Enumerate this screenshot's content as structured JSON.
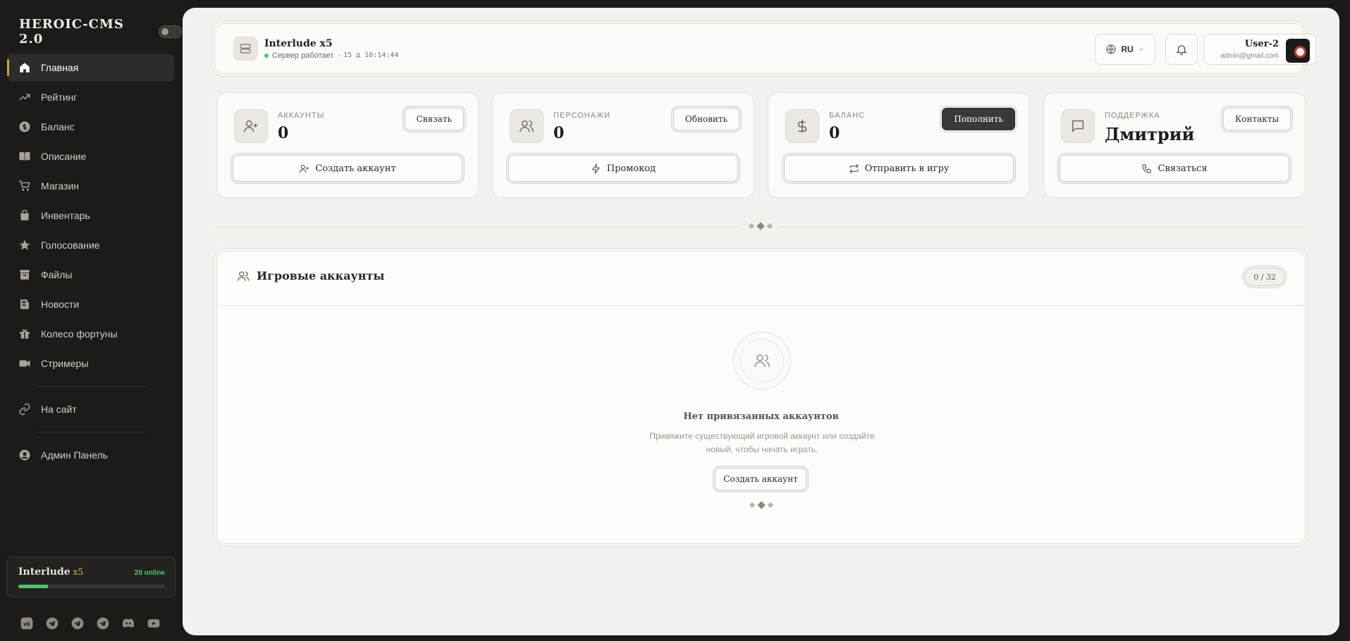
{
  "sidebar": {
    "brand": "HEROIC-CMS 2.0",
    "nav": [
      {
        "label": "Главная",
        "icon": "home-icon",
        "active": true
      },
      {
        "label": "Рейтинг",
        "icon": "trending-icon"
      },
      {
        "label": "Баланс",
        "icon": "dollar-circle-icon"
      },
      {
        "label": "Описание",
        "icon": "book-icon"
      },
      {
        "label": "Магазин",
        "icon": "cart-icon"
      },
      {
        "label": "Инвентарь",
        "icon": "bag-icon"
      },
      {
        "label": "Голосование",
        "icon": "star-icon"
      },
      {
        "label": "Файлы",
        "icon": "archive-icon"
      },
      {
        "label": "Новости",
        "icon": "newspaper-icon"
      },
      {
        "label": "Колесо фортуны",
        "icon": "gift-icon"
      },
      {
        "label": "Стримеры",
        "icon": "video-icon"
      }
    ],
    "link_site": "На сайт",
    "link_admin": "Админ Панель",
    "server": {
      "name": "Interlude",
      "rate": "x5",
      "online": "20 online",
      "load_fraction": 0.2
    },
    "socials": [
      "vk-icon",
      "telegram-icon",
      "telegram-icon",
      "telegram-icon",
      "discord-icon",
      "youtube-icon"
    ]
  },
  "topbar": {
    "server_title": "Interlude x5",
    "server_status": "Сервер работает",
    "separator": "·",
    "uptime": "15 д 10:14:44",
    "lang": "RU",
    "user_name": "User-2",
    "user_email": "admin@gmail.com"
  },
  "cards": [
    {
      "label": "АККАУНТЫ",
      "value": "0",
      "button": "Связать",
      "action": "Создать аккаунт",
      "icon": "user-plus-icon",
      "action_icon": "user-plus-icon"
    },
    {
      "label": "ПЕРСОНАЖИ",
      "value": "0",
      "button": "Обновить",
      "action": "Промокод",
      "icon": "users-icon",
      "action_icon": "zap-icon"
    },
    {
      "label": "БАЛАНС",
      "value": "0",
      "button": "Пополнить",
      "action": "Отправить в игру",
      "icon": "dollar-icon",
      "action_icon": "repeat-icon"
    },
    {
      "label": "ПОДДЕРЖКА",
      "value": "Дмитрий",
      "button": "Контакты",
      "action": "Связаться",
      "icon": "message-icon",
      "action_icon": "phone-icon"
    }
  ],
  "accounts_panel": {
    "title": "Игровые аккаунты",
    "count": "0 / 32",
    "empty_title": "Нет привязанных аккаунтов",
    "empty_text": "Привяжите существующий игровой аккаунт или создайте новый, чтобы начать играть.",
    "empty_button": "Создать аккаунт"
  },
  "colors": {
    "accent": "#c9a24a",
    "online": "#4cc76b",
    "sidebar_bg": "#1c1b19",
    "main_bg": "#f3f1ee"
  }
}
